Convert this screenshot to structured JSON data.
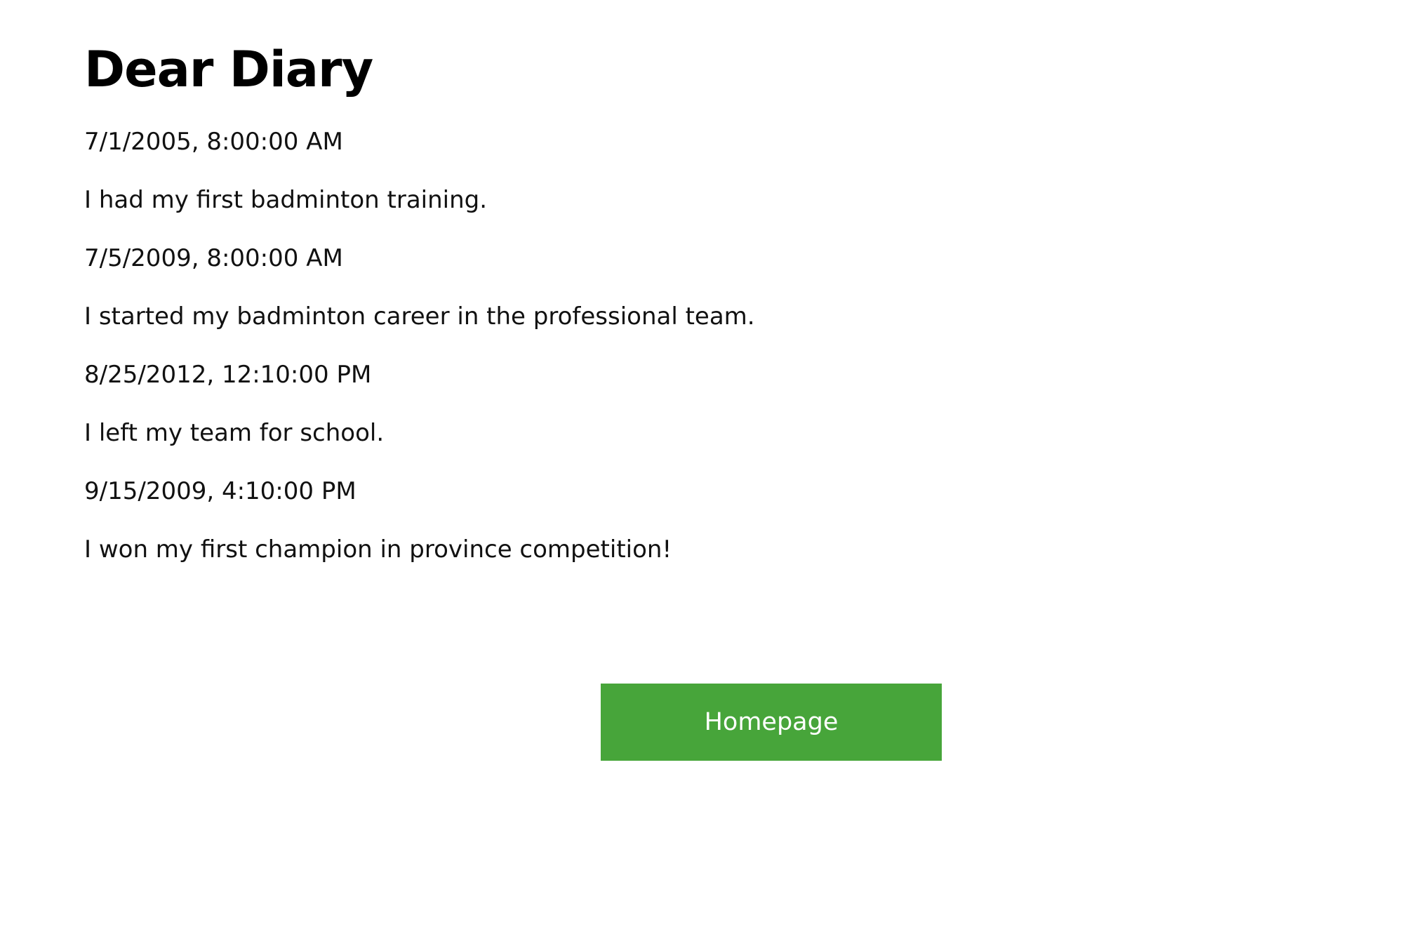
{
  "page": {
    "title": "Dear Diary"
  },
  "entries": [
    {
      "date": "7/1/2005, 8:00:00 AM",
      "text": "I had my first badminton training."
    },
    {
      "date": "7/5/2009, 8:00:00 AM",
      "text": "I started my badminton career in the professional team."
    },
    {
      "date": "8/25/2012, 12:10:00 PM",
      "text": "I left my team for school."
    },
    {
      "date": "9/15/2009, 4:10:00 PM",
      "text": "I won my first champion in province competition!"
    }
  ],
  "actions": {
    "homepage_label": "Homepage"
  },
  "colors": {
    "button_background": "#47a53a",
    "button_text": "#ffffff",
    "page_background": "#ffffff",
    "text": "#111111"
  }
}
